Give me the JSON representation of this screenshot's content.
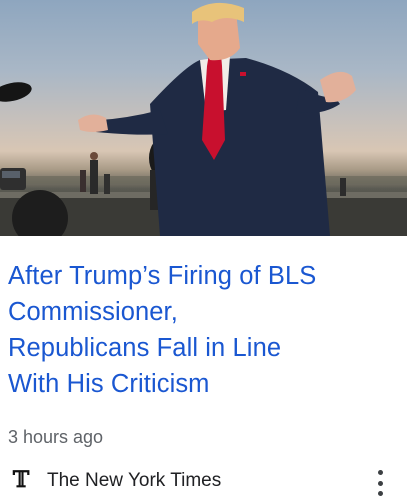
{
  "article": {
    "image_alt": "Donald Trump speaking to reporters on an airport tarmac",
    "headline_lines": [
      "After Trump’s Firing of BLS",
      "Commissioner,",
      "Republicans Fall in Line",
      "With His Criticism"
    ],
    "timestamp": "3 hours ago"
  },
  "source": {
    "logo": "𝕋",
    "name": "The New York Times",
    "logo_icon": "nyt-t-logo-icon",
    "menu_icon": "more-vert-icon"
  },
  "colors": {
    "headline": "#1a57d1",
    "timestamp": "#5f6368",
    "tie": "#c8102e",
    "suit": "#1f2a44"
  }
}
